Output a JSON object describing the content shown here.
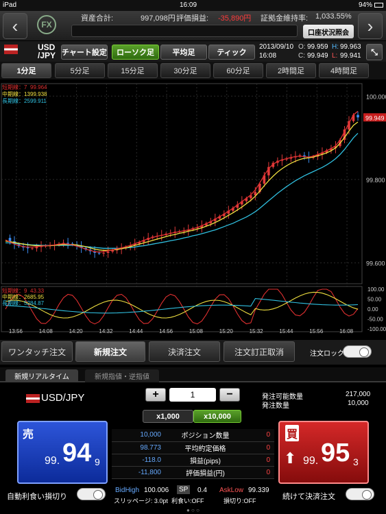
{
  "status": {
    "device": "iPad",
    "time": "16:09",
    "battery": "94%"
  },
  "header": {
    "assets_label": "資産合計:",
    "assets_value": "997,098円",
    "pl_label": "評価損益:",
    "pl_value": "-35,890円",
    "margin_label": "証拠金維持率:",
    "margin_value": "1,033.55%",
    "account_button": "口座状況照会",
    "logo": "FX"
  },
  "pair": {
    "name_top": "USD",
    "name_bottom": "/JPY",
    "chart_settings": "チャート設定",
    "chart_types": [
      "ローソク足",
      "平均足",
      "ティック"
    ],
    "active_type": "ローソク足",
    "date": "2013/09/10",
    "time": "16:08",
    "o_label": "O:",
    "o_value": "99.959",
    "h_label": "H:",
    "h_value": "99.963",
    "c_label": "C:",
    "c_value": "99.949",
    "l_label": "L:",
    "l_value": "99.941"
  },
  "timeframes": [
    "1分足",
    "5分足",
    "15分足",
    "30分足",
    "60分足",
    "2時間足",
    "4時間足"
  ],
  "active_timeframe": "1分足",
  "chart_data": {
    "type": "line",
    "legend": [
      {
        "label": "短期線：7",
        "value": "99.964",
        "color": "#e03030"
      },
      {
        "label": "中期線：13",
        "value": "99.938",
        "color": "#f0e040"
      },
      {
        "label": "長期線：25",
        "value": "99.911",
        "color": "#30c0e0"
      }
    ],
    "y_ticks": [
      "100.000",
      "99.800",
      "99.600"
    ],
    "current_price": "99.949",
    "x_ticks": [
      "13:56",
      "14:08",
      "14:20",
      "14:32",
      "14:44",
      "14:56",
      "15:08",
      "15:20",
      "15:32",
      "15:44",
      "15:56",
      "16:08"
    ],
    "close": [
      99.66,
      99.652,
      99.645,
      99.64,
      99.637,
      99.635,
      99.635,
      99.638,
      99.64,
      99.641,
      99.642,
      99.643,
      99.646,
      99.648,
      99.646,
      99.644,
      99.64,
      99.636,
      99.632,
      99.628,
      99.624,
      99.623,
      99.624,
      99.627,
      99.63,
      99.633,
      99.635,
      99.638,
      99.642,
      99.646,
      99.65,
      99.655,
      99.66,
      99.663,
      99.665,
      99.667,
      99.67,
      99.672,
      99.675,
      99.676,
      99.677,
      99.68,
      99.683,
      99.685,
      99.69,
      99.695,
      99.7,
      99.706,
      99.712,
      99.718,
      99.725,
      99.732,
      99.74,
      99.748,
      99.755,
      99.762,
      99.77,
      99.79,
      99.81,
      99.83,
      99.84,
      99.845,
      99.848,
      99.85,
      99.853,
      99.856,
      99.858,
      99.855,
      99.852,
      99.855,
      99.86,
      99.865,
      99.87,
      99.875,
      99.88,
      99.895,
      99.92,
      99.94,
      99.955,
      99.949
    ],
    "ma_short": [
      99.655,
      99.65,
      99.645,
      99.642,
      99.639,
      99.638,
      99.638,
      99.639,
      99.64,
      99.641,
      99.642,
      99.643,
      99.645,
      99.646,
      99.645,
      99.643,
      99.64,
      99.637,
      99.633,
      99.63,
      99.627,
      99.626,
      99.627,
      99.629,
      99.631,
      99.634,
      99.636,
      99.639,
      99.642,
      99.646,
      99.65,
      99.654,
      99.658,
      99.661,
      99.664,
      99.666,
      99.668,
      99.671,
      99.673,
      99.675,
      99.677,
      99.679,
      99.682,
      99.685,
      99.689,
      99.694,
      99.699,
      99.705,
      99.711,
      99.717,
      99.724,
      99.731,
      99.739,
      99.747,
      99.755,
      99.763,
      99.775,
      99.792,
      99.81,
      99.826,
      99.837,
      99.843,
      99.847,
      99.85,
      99.853,
      99.855,
      99.856,
      99.855,
      99.854,
      99.856,
      99.86,
      99.864,
      99.869,
      99.874,
      99.881,
      99.895,
      99.915,
      99.935,
      99.955,
      99.964
    ],
    "ma_mid": [
      99.652,
      99.651,
      99.649,
      99.647,
      99.645,
      99.643,
      99.642,
      99.641,
      99.641,
      99.641,
      99.641,
      99.642,
      99.643,
      99.644,
      99.644,
      99.644,
      99.643,
      99.641,
      99.639,
      99.636,
      99.633,
      99.631,
      99.63,
      99.63,
      99.631,
      99.632,
      99.634,
      99.636,
      99.639,
      99.642,
      99.645,
      99.648,
      99.651,
      99.654,
      99.657,
      99.66,
      99.663,
      99.666,
      99.668,
      99.671,
      99.673,
      99.676,
      99.678,
      99.681,
      99.684,
      99.688,
      99.692,
      99.697,
      99.702,
      99.708,
      99.714,
      99.72,
      99.727,
      99.734,
      99.742,
      99.75,
      99.76,
      99.772,
      99.785,
      99.797,
      99.808,
      99.818,
      99.826,
      99.833,
      99.839,
      99.844,
      99.848,
      99.851,
      99.852,
      99.854,
      99.857,
      99.86,
      99.864,
      99.869,
      99.876,
      99.887,
      99.901,
      99.916,
      99.93,
      99.938
    ],
    "ma_long": [
      99.648,
      99.648,
      99.647,
      99.646,
      99.645,
      99.644,
      99.643,
      99.643,
      99.642,
      99.642,
      99.642,
      99.642,
      99.642,
      99.642,
      99.642,
      99.642,
      99.641,
      99.64,
      99.639,
      99.638,
      99.637,
      99.636,
      99.635,
      99.635,
      99.635,
      99.635,
      99.635,
      99.636,
      99.637,
      99.638,
      99.64,
      99.641,
      99.643,
      99.645,
      99.647,
      99.649,
      99.651,
      99.653,
      99.655,
      99.657,
      99.66,
      99.662,
      99.665,
      99.667,
      99.67,
      99.673,
      99.676,
      99.679,
      99.683,
      99.687,
      99.691,
      99.695,
      99.7,
      99.705,
      99.71,
      99.716,
      99.723,
      99.731,
      99.74,
      99.749,
      99.758,
      99.767,
      99.775,
      99.783,
      99.79,
      99.797,
      99.803,
      99.809,
      99.814,
      99.819,
      99.824,
      99.829,
      99.835,
      99.842,
      99.85,
      99.86,
      99.872,
      99.886,
      99.9,
      99.911
    ],
    "y_range": [
      99.55,
      100.03
    ],
    "osc_legend": [
      {
        "label": "短期線：9",
        "value": "43.33",
        "color": "#e03030"
      },
      {
        "label": "中期線：26",
        "value": "85.95",
        "color": "#f0e040"
      },
      {
        "label": "長期線：52",
        "value": "84.87",
        "color": "#30c0e0"
      }
    ],
    "osc_ticks": [
      "100.00",
      "50.00",
      "0.00",
      "-50.00",
      "-100.00"
    ]
  },
  "tabs": {
    "items": [
      "ワンタッチ注文",
      "新規注文",
      "決済注文",
      "注文訂正取消"
    ],
    "active": "新規注文",
    "lock_label": "注文ロック"
  },
  "subtabs": [
    "新規リアルタイム",
    "新規指値・逆指値"
  ],
  "order": {
    "pair": "USD/JPY",
    "quantity": "1",
    "units": [
      "x1,000",
      "x10,000"
    ],
    "active_unit": "x10,000",
    "available_label": "発注可能数量",
    "available_value": "217,000",
    "order_qty_label": "発注数量",
    "order_qty_value": "10,000"
  },
  "sell": {
    "label": "売",
    "prefix": "99.",
    "big": "94",
    "suffix": "9"
  },
  "buy": {
    "label": "買",
    "prefix": "99.",
    "big": "95",
    "suffix": "3"
  },
  "stats": [
    {
      "left": "10,000",
      "label": "ポジション数量",
      "right": "0"
    },
    {
      "left": "98.773",
      "label": "平均約定価格",
      "right": "0"
    },
    {
      "left": "-118.0",
      "label": "損益(pips)",
      "right": "0"
    },
    {
      "left": "-11,800",
      "label": "評価損益(円)",
      "right": "0"
    }
  ],
  "bottom": {
    "auto_label": "自動利食い損切り",
    "bidhigh_label": "BidHigh",
    "bidhigh": "100.006",
    "sp_label": "SP",
    "sp": "0.4",
    "asklow_label": "AskLow",
    "asklow": "99.339",
    "slippage": "スリッページ: 3.0pt",
    "takeprofit": "利食い:OFF",
    "stoploss": "損切り:OFF",
    "settle_label": "続けて決済注文"
  },
  "colors": {
    "sell": "#1a3fc4",
    "buy": "#b31515",
    "accent": "#4c9a1f"
  }
}
